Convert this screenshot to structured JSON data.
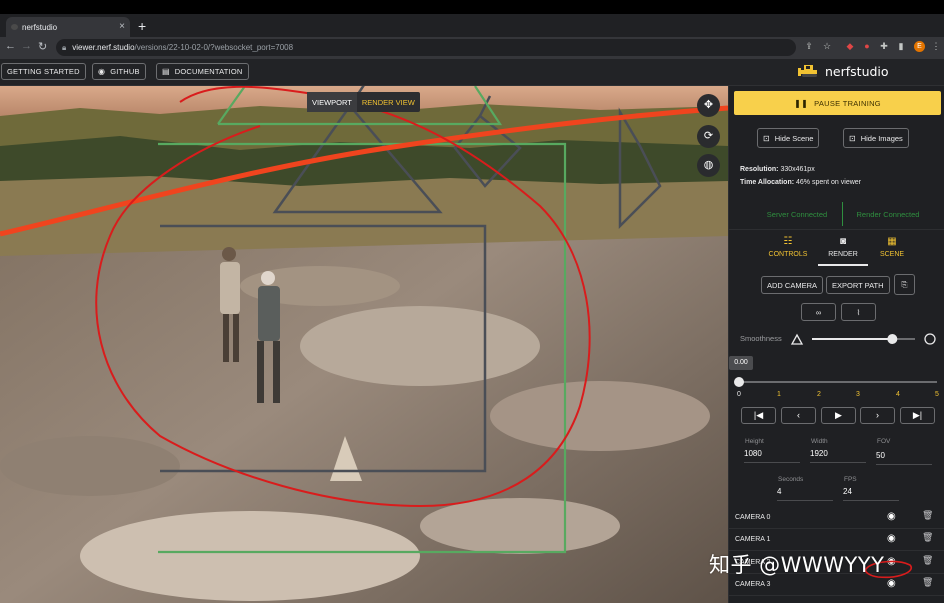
{
  "browser": {
    "tab_title": "nerfstudio",
    "tab_close": "×",
    "new_tab": "+",
    "url_host": "viewer.nerf.studio",
    "url_path": "/versions/22-10-02-0/?websocket_port=7008",
    "profile_initial": "E"
  },
  "topbar": {
    "getting_started": "GETTING STARTED",
    "github": "GITHUB",
    "documentation": "DOCUMENTATION",
    "logo_text": "nerfstudio"
  },
  "viewport": {
    "toggle_viewport": "VIEWPORT",
    "toggle_render": "RENDER VIEW"
  },
  "panel": {
    "pause_label": "PAUSE TRAINING",
    "hide_scene": "Hide Scene",
    "hide_images": "Hide Images",
    "resolution_label": "Resolution:",
    "resolution_value": "330x461px",
    "time_label": "Time Allocation:",
    "time_value": "46% spent on viewer",
    "server_status": "Server Connected",
    "render_status": "Render Connected",
    "tabs": [
      {
        "label": "CONTROLS"
      },
      {
        "label": "RENDER"
      },
      {
        "label": "SCENE"
      }
    ],
    "add_camera": "ADD CAMERA",
    "export_path": "EXPORT PATH",
    "smoothness_label": "Smoothness",
    "smoothness_level": 0.78,
    "timeline_value": "0.00",
    "ticks": [
      "0",
      "1",
      "2",
      "3",
      "4",
      "5"
    ],
    "height_label": "Height",
    "height_value": "1080",
    "width_label": "Width",
    "width_value": "1920",
    "fov_label": "FOV",
    "fov_value": "50",
    "seconds_label": "Seconds",
    "seconds_value": "4",
    "fps_label": "FPS",
    "fps_value": "24",
    "cameras": [
      {
        "label": "CAMERA 0"
      },
      {
        "label": "CAMERA 1"
      },
      {
        "label": "CAMERA 2"
      },
      {
        "label": "CAMERA 3"
      }
    ]
  },
  "watermark": "知乎 @WWWYYY"
}
